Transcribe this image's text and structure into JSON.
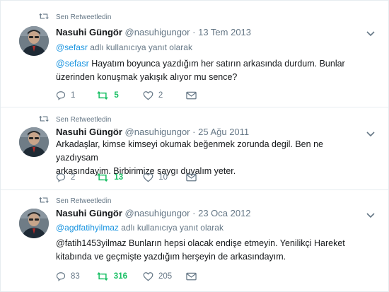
{
  "colors": {
    "retweet_green": "#17bf63",
    "link_blue": "#1b95e0",
    "muted": "#657786",
    "text": "#14171a",
    "divider": "#e6ecf0"
  },
  "tweets": [
    {
      "retweet_label": "Sen Retweetledin",
      "author_name": "Nasuhi Güngör",
      "author_handle": "@nasuhigungor",
      "separator": "·",
      "date": "13 Tem 2013",
      "reply_mention": "@sefasr",
      "reply_suffix": "adlı kullanıcıya yanıt olarak",
      "text_mention": "@sefasr",
      "text_line1_rest": " Hayatım boyunca yazdığım her satırın arkasında durdum. Bunlar",
      "text_line2": "üzerinden konuşmak yakışık alıyor mu sence?",
      "reply_count": "1",
      "retweet_count": "5",
      "like_count": "2"
    },
    {
      "retweet_label": "Sen Retweetledin",
      "author_name": "Nasuhi Güngör",
      "author_handle": "@nasuhigungor",
      "separator": "·",
      "date": "25 Ağu 2011",
      "text_line1": "Arkadaşlar, kimse kimseyi okumak beğenmek zorunda degil. Ben ne yazdıysam",
      "text_line2": "arkasındayim. Birbirimize saygı duyalım yeter.",
      "reply_count": "2",
      "retweet_count": "13",
      "like_count": "10"
    },
    {
      "retweet_label": "Sen Retweetledin",
      "author_name": "Nasuhi Güngör",
      "author_handle": "@nasuhigungor",
      "separator": "·",
      "date": "23 Oca 2012",
      "reply_mention": "@agdfatihyilmaz",
      "reply_suffix": "adlı kullanıcıya yanıt olarak",
      "text_line1": "@fatih1453yilmaz Bunların hepsi olacak endişe etmeyin. Yenilikçi Hareket",
      "text_line2": "kitabında ve geçmişte yazdığım herşeyin de arkasındayım.",
      "reply_count": "83",
      "retweet_count": "316",
      "like_count": "205"
    }
  ]
}
